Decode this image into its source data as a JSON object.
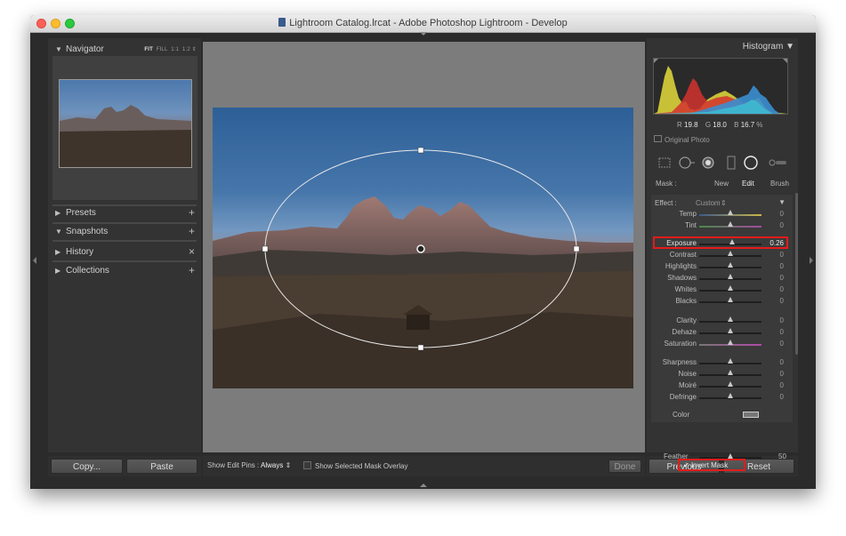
{
  "window": {
    "title": "Lightroom Catalog.lrcat - Adobe Photoshop Lightroom - Develop"
  },
  "left_panel": {
    "navigator": {
      "title": "Navigator",
      "modes": [
        "FIT",
        "FILL",
        "1:1",
        "1:2"
      ],
      "active_mode": "FIT"
    },
    "sections": [
      {
        "label": "Presets",
        "action": "+"
      },
      {
        "label": "Snapshots",
        "action": "+"
      },
      {
        "label": "History",
        "action": "×"
      },
      {
        "label": "Collections",
        "action": "+"
      }
    ],
    "copy_label": "Copy...",
    "paste_label": "Paste"
  },
  "toolbar": {
    "show_edit_pins_label": "Show Edit Pins :",
    "show_edit_pins_value": "Always",
    "mask_overlay_label": "Show Selected Mask Overlay",
    "done_label": "Done"
  },
  "right_panel": {
    "histogram": {
      "title": "Histogram",
      "r_label": "R",
      "r_value": "19.8",
      "g_label": "G",
      "g_value": "18.0",
      "b_label": "B",
      "b_value": "16.7",
      "unit": "%",
      "original_photo_label": "Original Photo"
    },
    "mask": {
      "label": "Mask :",
      "new": "New",
      "edit": "Edit",
      "brush": "Brush"
    },
    "effect": {
      "label": "Effect :",
      "value": "Custom"
    },
    "sliders": [
      {
        "name": "Temp",
        "value": "0",
        "pos": 0.5
      },
      {
        "name": "Tint",
        "value": "0",
        "pos": 0.5
      },
      {
        "name": "Exposure",
        "value": "0.26",
        "pos": 0.53
      },
      {
        "name": "Contrast",
        "value": "0",
        "pos": 0.5
      },
      {
        "name": "Highlights",
        "value": "0",
        "pos": 0.5
      },
      {
        "name": "Shadows",
        "value": "0",
        "pos": 0.5
      },
      {
        "name": "Whites",
        "value": "0",
        "pos": 0.5
      },
      {
        "name": "Blacks",
        "value": "0",
        "pos": 0.5
      },
      {
        "name": "Clarity",
        "value": "0",
        "pos": 0.5
      },
      {
        "name": "Dehaze",
        "value": "0",
        "pos": 0.5
      },
      {
        "name": "Saturation",
        "value": "0",
        "pos": 0.5
      },
      {
        "name": "Sharpness",
        "value": "0",
        "pos": 0.5
      },
      {
        "name": "Noise",
        "value": "0",
        "pos": 0.5
      },
      {
        "name": "Moiré",
        "value": "0",
        "pos": 0.5
      },
      {
        "name": "Defringe",
        "value": "0",
        "pos": 0.5
      }
    ],
    "color_label": "Color",
    "feather_label": "Feather",
    "feather_value": "50",
    "feather_pos": 0.5,
    "invert_mask_label": "Invert Mask",
    "invert_mask_checked": true,
    "previous_label": "Previous",
    "reset_label": "Reset"
  },
  "colors": {
    "highlight_box": "#e41b1b",
    "panel_bg": "#333333"
  }
}
